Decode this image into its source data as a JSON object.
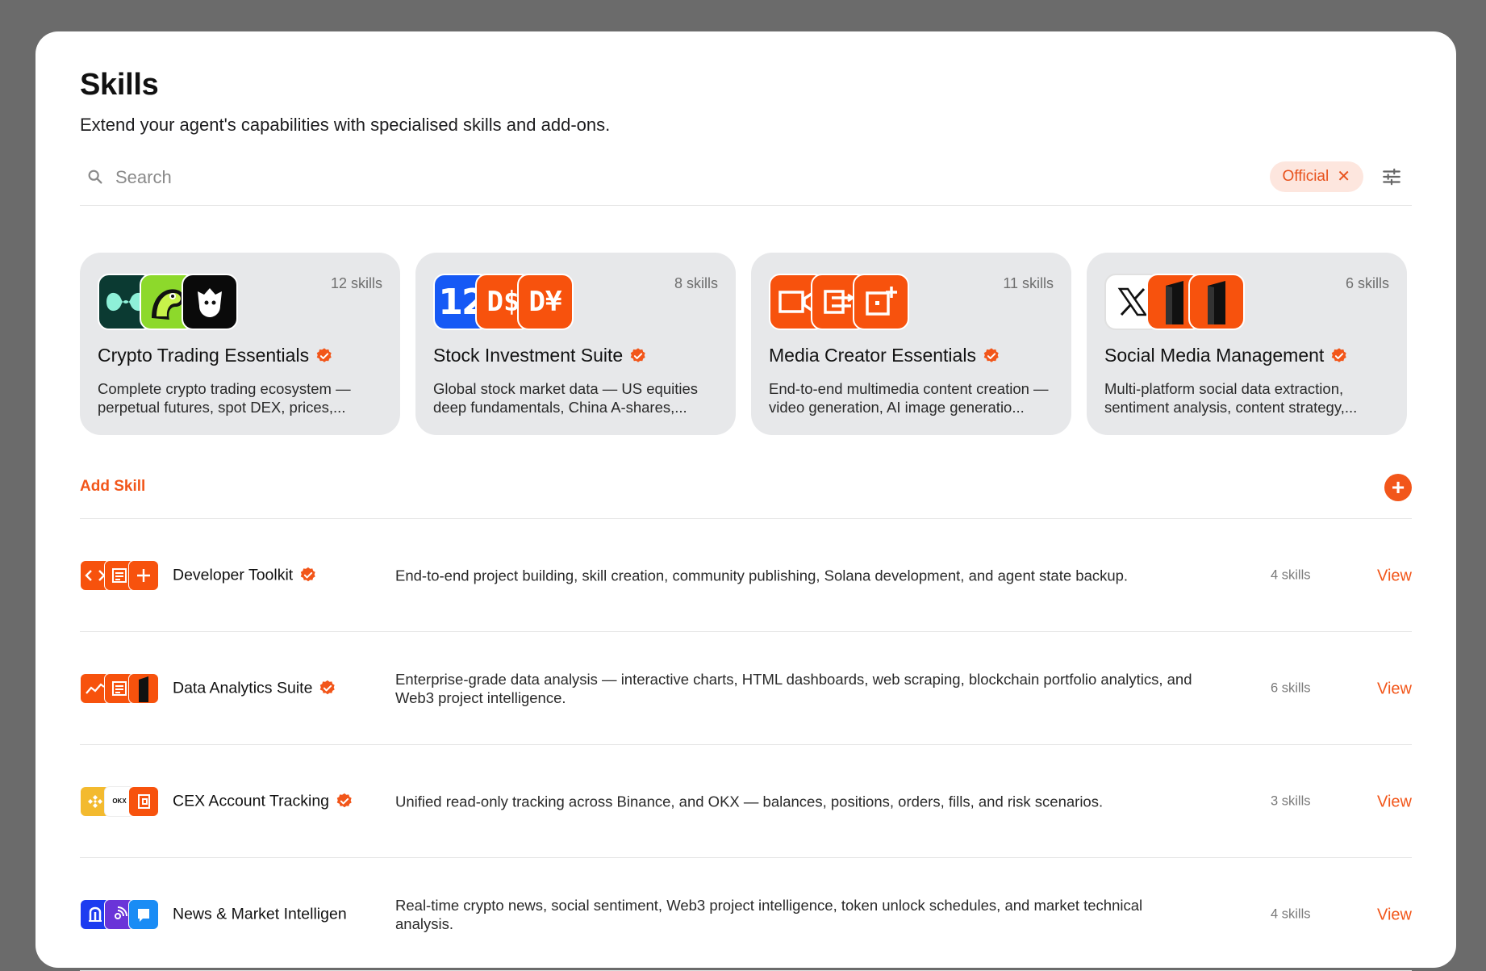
{
  "page": {
    "title": "Skills",
    "subtitle": "Extend your agent's capabilities with specialised skills and add-ons."
  },
  "search": {
    "placeholder": "Search"
  },
  "filter_chip": {
    "label": "Official",
    "remove_icon": "close-icon"
  },
  "colors": {
    "accent": "#f2561a",
    "card_bg": "#e7e8ea",
    "chip_bg": "#fde6de"
  },
  "featured": [
    {
      "name": "Crypto Trading Essentials",
      "count": "12 skills",
      "desc": "Complete crypto trading ecosystem — perpetual futures, spot DEX, prices,...",
      "icons": [
        "hyperliquid-icon",
        "parrot-icon",
        "robot-head-icon"
      ]
    },
    {
      "name": "Stock Investment Suite",
      "count": "8 skills",
      "desc": "Global stock market data — US equities deep fundamentals, China A-shares,...",
      "icons": [
        "twelve-data-icon",
        "dollar-icon",
        "yuan-icon"
      ]
    },
    {
      "name": "Media Creator Essentials",
      "count": "11 skills",
      "desc": "End-to-end multimedia content creation — video generation, AI image generatio...",
      "icons": [
        "video-icon",
        "transfer-icon",
        "image-add-icon"
      ]
    },
    {
      "name": "Social Media Management",
      "count": "6 skills",
      "desc": "Multi-platform social data extraction, sentiment analysis, content strategy,...",
      "icons": [
        "x-logo-icon",
        "block-icon",
        "block-icon"
      ]
    }
  ],
  "featured_icon_text": {
    "twelve": "12",
    "dollar": "D$",
    "yuan": "D¥",
    "x": "𝕏"
  },
  "add_skill": {
    "label": "Add Skill"
  },
  "rows": [
    {
      "name": "Developer Toolkit",
      "verified": true,
      "desc": "End-to-end project building, skill creation, community publishing, Solana development, and agent state backup.",
      "count": "4 skills",
      "action": "View",
      "icons": [
        "code-icon",
        "terminal-icon",
        "plus-icon"
      ]
    },
    {
      "name": "Data Analytics Suite",
      "verified": true,
      "desc": "Enterprise-grade data analysis — interactive charts, HTML dashboards, web scraping, blockchain portfolio analytics, and Web3 project intelligence.",
      "count": "6 skills",
      "action": "View",
      "icons": [
        "chart-line-icon",
        "dashboard-icon",
        "block-icon"
      ]
    },
    {
      "name": "CEX Account Tracking",
      "verified": true,
      "desc": "Unified read-only tracking across Binance, and OKX — balances, positions, orders, fills, and risk scenarios.",
      "count": "3 skills",
      "action": "View",
      "icons": [
        "binance-icon",
        "okx-icon",
        "wallet-icon"
      ],
      "okx_text": "OKX"
    },
    {
      "name": "News & Market Intelligen",
      "verified": false,
      "desc": "Real-time crypto news, social sentiment, Web3 project intelligence, token unlock schedules, and market technical analysis.",
      "count": "4 skills",
      "action": "View",
      "icons": [
        "news-icon",
        "signal-icon",
        "message-icon"
      ]
    }
  ]
}
